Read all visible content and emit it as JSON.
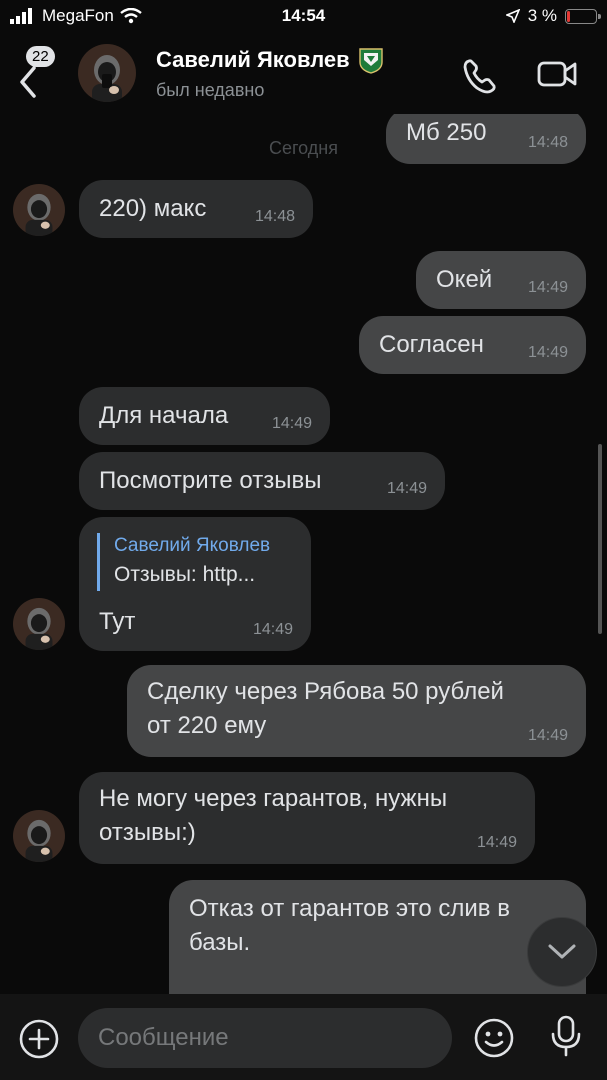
{
  "status_bar": {
    "carrier": "MegaFon",
    "time": "14:54",
    "battery": "3 %",
    "battery_level_percent": 3,
    "icons": [
      "signal-icon",
      "wifi-icon",
      "location-arrow-icon",
      "battery-icon"
    ]
  },
  "header": {
    "unread_count": "22",
    "name": "Савелий Яковлев",
    "status": "был недавно",
    "icons": [
      "back-chevron-icon",
      "avatar",
      "club-badge-icon",
      "phone-icon",
      "video-camera-icon"
    ]
  },
  "chat": {
    "date_separator": "Сегодня",
    "messages": [
      {
        "dir": "out",
        "text": "Мб 250",
        "time": "14:48"
      },
      {
        "dir": "in",
        "text": "220) макс",
        "time": "14:48"
      },
      {
        "dir": "out",
        "text": "Окей",
        "time": "14:49"
      },
      {
        "dir": "out",
        "text": "Согласен",
        "time": "14:49"
      },
      {
        "dir": "in",
        "text": "Для начала",
        "time": "14:49"
      },
      {
        "dir": "in",
        "text": "Посмотрите отзывы",
        "time": "14:49"
      },
      {
        "dir": "in",
        "reply_author": "Савелий Яковлев",
        "reply_text": "Отзывы: http...",
        "text": "Тут",
        "time": "14:49"
      },
      {
        "dir": "out",
        "text_line1": "Сделку через Рябова 50 рублей",
        "text_line2": "от 220 ему",
        "time": "14:49"
      },
      {
        "dir": "in",
        "text_line1": "Не могу через гарантов, нужны",
        "text_line2": "отзывы:)",
        "time": "14:49"
      },
      {
        "dir": "out",
        "text_line1": "Отказ от гарантов это слив в",
        "text_line2": "базы."
      }
    ]
  },
  "composer": {
    "placeholder": "Сообщение",
    "icons": [
      "plus-icon",
      "emoji-icon",
      "microphone-icon"
    ]
  },
  "colors": {
    "background": "#0a0a0a",
    "incoming_bubble": "#2c2d2e",
    "outgoing_bubble": "#454647",
    "accent": "#71aaeb",
    "text": "#e1e3e6",
    "secondary_text": "#8c9195"
  }
}
